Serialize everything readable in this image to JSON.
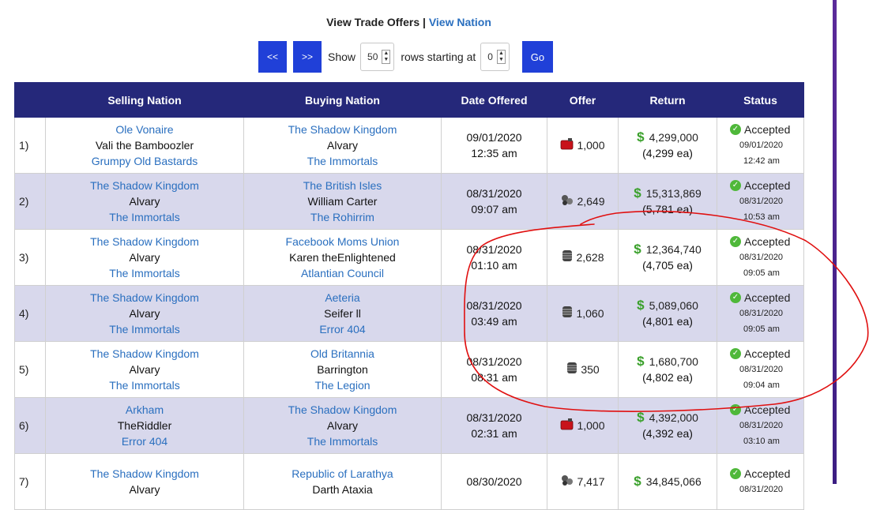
{
  "header": {
    "view_trade_offers": "View Trade Offers",
    "separator": " | ",
    "view_nation": "View Nation"
  },
  "controls": {
    "prev_label": "<<",
    "next_label": ">>",
    "show_label": "Show",
    "rows_value": "50",
    "rows_label": "rows starting at",
    "start_value": "0",
    "go_label": "Go"
  },
  "table": {
    "columns": [
      "Selling Nation",
      "Buying Nation",
      "Date Offered",
      "Offer",
      "Return",
      "Status"
    ],
    "rows": [
      {
        "num": "1)",
        "seller": {
          "nation": "Ole Vonaire",
          "leader": "Vali the Bamboozler",
          "alliance": "Grumpy Old Bastards"
        },
        "buyer": {
          "nation": "The Shadow Kingdom",
          "leader": "Alvary",
          "alliance": "The Immortals"
        },
        "date": "09/01/2020",
        "time": "12:35 am",
        "offer_icon": "gasoline-icon",
        "offer": "1,000",
        "return_total": "4,299,000",
        "return_each": "(4,299 ea)",
        "status": "Accepted",
        "status_date": "09/01/2020",
        "status_time": "12:42 am"
      },
      {
        "num": "2)",
        "seller": {
          "nation": "The Shadow Kingdom",
          "leader": "Alvary",
          "alliance": "The Immortals"
        },
        "buyer": {
          "nation": "The British Isles",
          "leader": "William Carter",
          "alliance": "The Rohirrim"
        },
        "date": "08/31/2020",
        "time": "09:07 am",
        "offer_icon": "munitions-icon",
        "offer": "2,649",
        "return_total": "15,313,869",
        "return_each": "(5,781 ea)",
        "status": "Accepted",
        "status_date": "08/31/2020",
        "status_time": "10:53 am"
      },
      {
        "num": "3)",
        "seller": {
          "nation": "The Shadow Kingdom",
          "leader": "Alvary",
          "alliance": "The Immortals"
        },
        "buyer": {
          "nation": "Facebook Moms Union",
          "leader": "Karen theEnlightened",
          "alliance": "Atlantian Council"
        },
        "date": "08/31/2020",
        "time": "01:10 am",
        "offer_icon": "steel-icon",
        "offer": "2,628",
        "return_total": "12,364,740",
        "return_each": "(4,705 ea)",
        "status": "Accepted",
        "status_date": "08/31/2020",
        "status_time": "09:05 am"
      },
      {
        "num": "4)",
        "seller": {
          "nation": "The Shadow Kingdom",
          "leader": "Alvary",
          "alliance": "The Immortals"
        },
        "buyer": {
          "nation": "Aeteria",
          "leader": "Seifer ll",
          "alliance": "Error 404"
        },
        "date": "08/31/2020",
        "time": "03:49 am",
        "offer_icon": "steel-icon",
        "offer": "1,060",
        "return_total": "5,089,060",
        "return_each": "(4,801 ea)",
        "status": "Accepted",
        "status_date": "08/31/2020",
        "status_time": "09:05 am"
      },
      {
        "num": "5)",
        "seller": {
          "nation": "The Shadow Kingdom",
          "leader": "Alvary",
          "alliance": "The Immortals"
        },
        "buyer": {
          "nation": "Old Britannia",
          "leader": "Barrington",
          "alliance": "The Legion"
        },
        "date": "08/31/2020",
        "time": "08:31 am",
        "offer_icon": "steel-icon",
        "offer": "350",
        "return_total": "1,680,700",
        "return_each": "(4,802 ea)",
        "status": "Accepted",
        "status_date": "08/31/2020",
        "status_time": "09:04 am"
      },
      {
        "num": "6)",
        "seller": {
          "nation": "Arkham",
          "leader": "TheRiddler",
          "alliance": "Error 404"
        },
        "buyer": {
          "nation": "The Shadow Kingdom",
          "leader": "Alvary",
          "alliance": "The Immortals"
        },
        "date": "08/31/2020",
        "time": "02:31 am",
        "offer_icon": "gasoline-icon",
        "offer": "1,000",
        "return_total": "4,392,000",
        "return_each": "(4,392 ea)",
        "status": "Accepted",
        "status_date": "08/31/2020",
        "status_time": "03:10 am"
      },
      {
        "num": "7)",
        "seller": {
          "nation": "The Shadow Kingdom",
          "leader": "Alvary",
          "alliance": ""
        },
        "buyer": {
          "nation": "Republic of Larathya",
          "leader": "Darth Ataxia",
          "alliance": ""
        },
        "date": "08/30/2020",
        "time": "",
        "offer_icon": "munitions-icon",
        "offer": "7,417",
        "return_total": "34,845,066",
        "return_each": "",
        "status": "Accepted",
        "status_date": "08/31/2020",
        "status_time": ""
      }
    ]
  },
  "colors": {
    "header_bg": "#25287a",
    "link": "#2a6fbf",
    "row_alt": "#d8d8ec",
    "button": "#2040d8",
    "annotation": "#e01010"
  }
}
